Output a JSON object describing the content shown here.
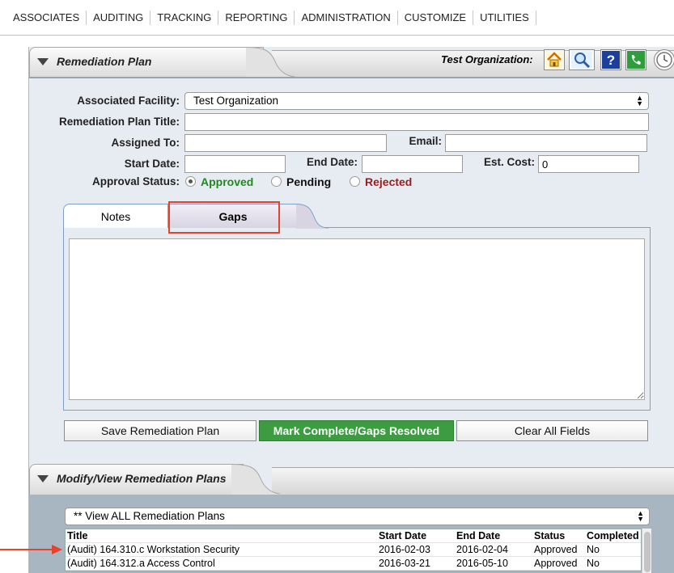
{
  "nav": {
    "items": [
      "ASSOCIATES",
      "AUDITING",
      "TRACKING",
      "REPORTING",
      "ADMINISTRATION",
      "CUSTOMIZE",
      "UTILITIES"
    ]
  },
  "remediation": {
    "title": "Remediation Plan",
    "org_label": "Test Organization:",
    "icons": [
      "home-icon",
      "search-icon",
      "help-icon",
      "phone-icon",
      "clock-icon"
    ],
    "facility_label": "Associated Facility:",
    "facility_value": "Test Organization",
    "plan_title_label": "Remediation Plan Title:",
    "plan_title_value": "",
    "assigned_label": "Assigned To:",
    "assigned_value": "",
    "email_label": "Email:",
    "email_value": "",
    "start_label": "Start Date:",
    "start_value": "",
    "end_label": "End Date:",
    "end_value": "",
    "cost_label": "Est. Cost:",
    "cost_value": "0",
    "approval_label": "Approval Status:",
    "approval_options": [
      {
        "label": "Approved",
        "color": "#1e8a1e",
        "checked": true
      },
      {
        "label": "Pending",
        "color": "#111111",
        "checked": false
      },
      {
        "label": "Rejected",
        "color": "#9b1c1c",
        "checked": false
      }
    ],
    "tabs": [
      "Notes",
      "Gaps"
    ],
    "notes_value": "",
    "buttons": {
      "save": "Save Remediation Plan",
      "complete": "Mark Complete/Gaps Resolved",
      "clear": "Clear All Fields"
    }
  },
  "modify": {
    "title": "Modify/View Remediation Plans",
    "filter_value": "** View ALL Remediation Plans",
    "columns": [
      "Title",
      "Start Date",
      "End Date",
      "Status",
      "Completed"
    ],
    "rows": [
      [
        "(Audit) 164.310.c Workstation Security",
        "2016-02-03",
        "2016-02-04",
        "Approved",
        "No"
      ],
      [
        "(Audit) 164.312.a Access Control",
        "2016-03-21",
        "2016-05-10",
        "Approved",
        "No"
      ]
    ]
  },
  "colors": {
    "accent_green": "#3d9c42",
    "highlight_red": "#e8412c"
  }
}
